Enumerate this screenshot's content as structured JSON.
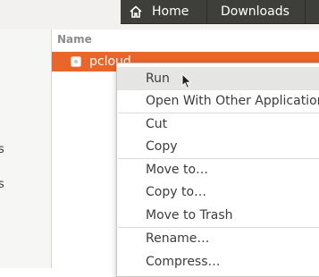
{
  "breadcrumbs": {
    "home": "Home",
    "downloads": "Downloads"
  },
  "sidebar": {
    "fragment_1": "s",
    "fragment_2": "s"
  },
  "file_list": {
    "column_name": "Name",
    "selected_file": "pcloud"
  },
  "context_menu": {
    "items": [
      "Run",
      "Open With Other Application",
      "Cut",
      "Copy",
      "Move to…",
      "Copy to…",
      "Move to Trash",
      "Rename…",
      "Compress…"
    ]
  },
  "colors": {
    "selection": "#e9652a",
    "path_bar": "#3e3e3b"
  },
  "icons": {
    "home": "home-icon",
    "file": "file-icon",
    "cursor": "mouse-pointer-icon"
  }
}
